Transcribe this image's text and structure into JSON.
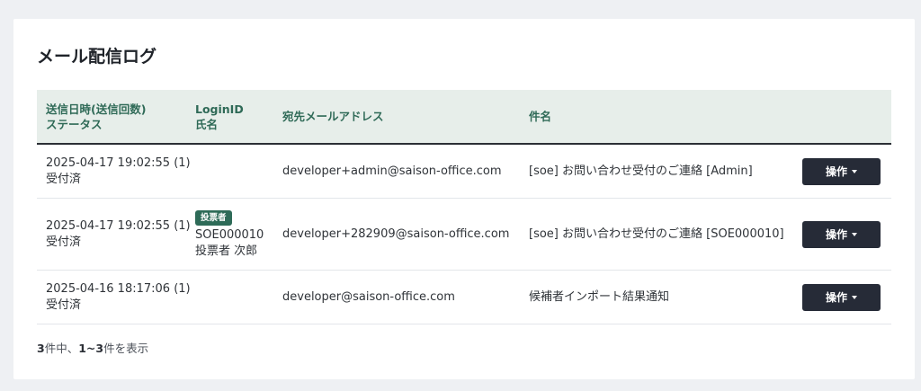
{
  "page": {
    "title": "メール配信ログ"
  },
  "table": {
    "headers": {
      "sent": [
        "送信日時(送信回数)",
        "ステータス"
      ],
      "login": [
        "LoginID",
        "氏名"
      ],
      "email": "宛先メールアドレス",
      "subject": "件名"
    },
    "rows": [
      {
        "sent_at": "2025-04-17 19:02:55 (1)",
        "status": "受付済",
        "badge": "",
        "login_id": "",
        "name": "",
        "email": "developer+admin@saison-office.com",
        "subject": "[soe] お問い合わせ受付のご連絡 [Admin]",
        "action_label": "操作"
      },
      {
        "sent_at": "2025-04-17 19:02:55 (1)",
        "status": "受付済",
        "badge": "投票者",
        "login_id": "SOE000010",
        "name": "投票者 次郎",
        "email": "developer+282909@saison-office.com",
        "subject": "[soe] お問い合わせ受付のご連絡 [SOE000010]",
        "action_label": "操作"
      },
      {
        "sent_at": "2025-04-16 18:17:06 (1)",
        "status": "受付済",
        "badge": "",
        "login_id": "",
        "name": "",
        "email": "developer@saison-office.com",
        "subject": "候補者インポート結果通知",
        "action_label": "操作"
      }
    ]
  },
  "pagination": {
    "total": "3",
    "total_suffix": "件中、",
    "range": "1~3",
    "range_suffix": "件を表示"
  },
  "icons": {
    "action_caret": "caret-down-icon"
  },
  "colors": {
    "header_text": "#2f6a57",
    "badge_bg": "#2e6b58",
    "button_bg": "#262b37"
  }
}
